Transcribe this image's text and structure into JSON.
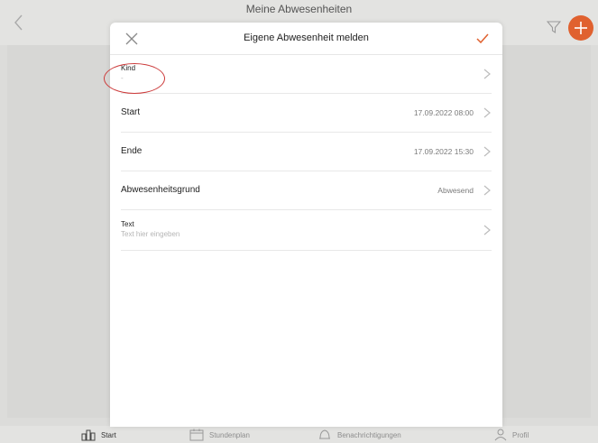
{
  "background": {
    "title": "Meine Abwesenheiten",
    "tabs": [
      {
        "label": "Start",
        "icon": "home-icon"
      },
      {
        "label": "Stundenplan",
        "icon": "calendar-icon"
      },
      {
        "label": "Benachrichtigungen",
        "icon": "bell-icon"
      },
      {
        "label": "Profil",
        "icon": "person-icon"
      }
    ]
  },
  "modal": {
    "title": "Eigene Abwesenheit melden",
    "rows": [
      {
        "label": "Kind",
        "sub": "-"
      },
      {
        "label": "Start",
        "value": "17.09.2022 08:00"
      },
      {
        "label": "Ende",
        "value": "17.09.2022 15:30"
      },
      {
        "label": "Abwesenheitsgrund",
        "value": "Abwesend"
      },
      {
        "label": "Text",
        "placeholder": "Text hier eingeben"
      }
    ]
  },
  "colors": {
    "accent": "#e0612f",
    "annotation": "#cc3a3a"
  }
}
